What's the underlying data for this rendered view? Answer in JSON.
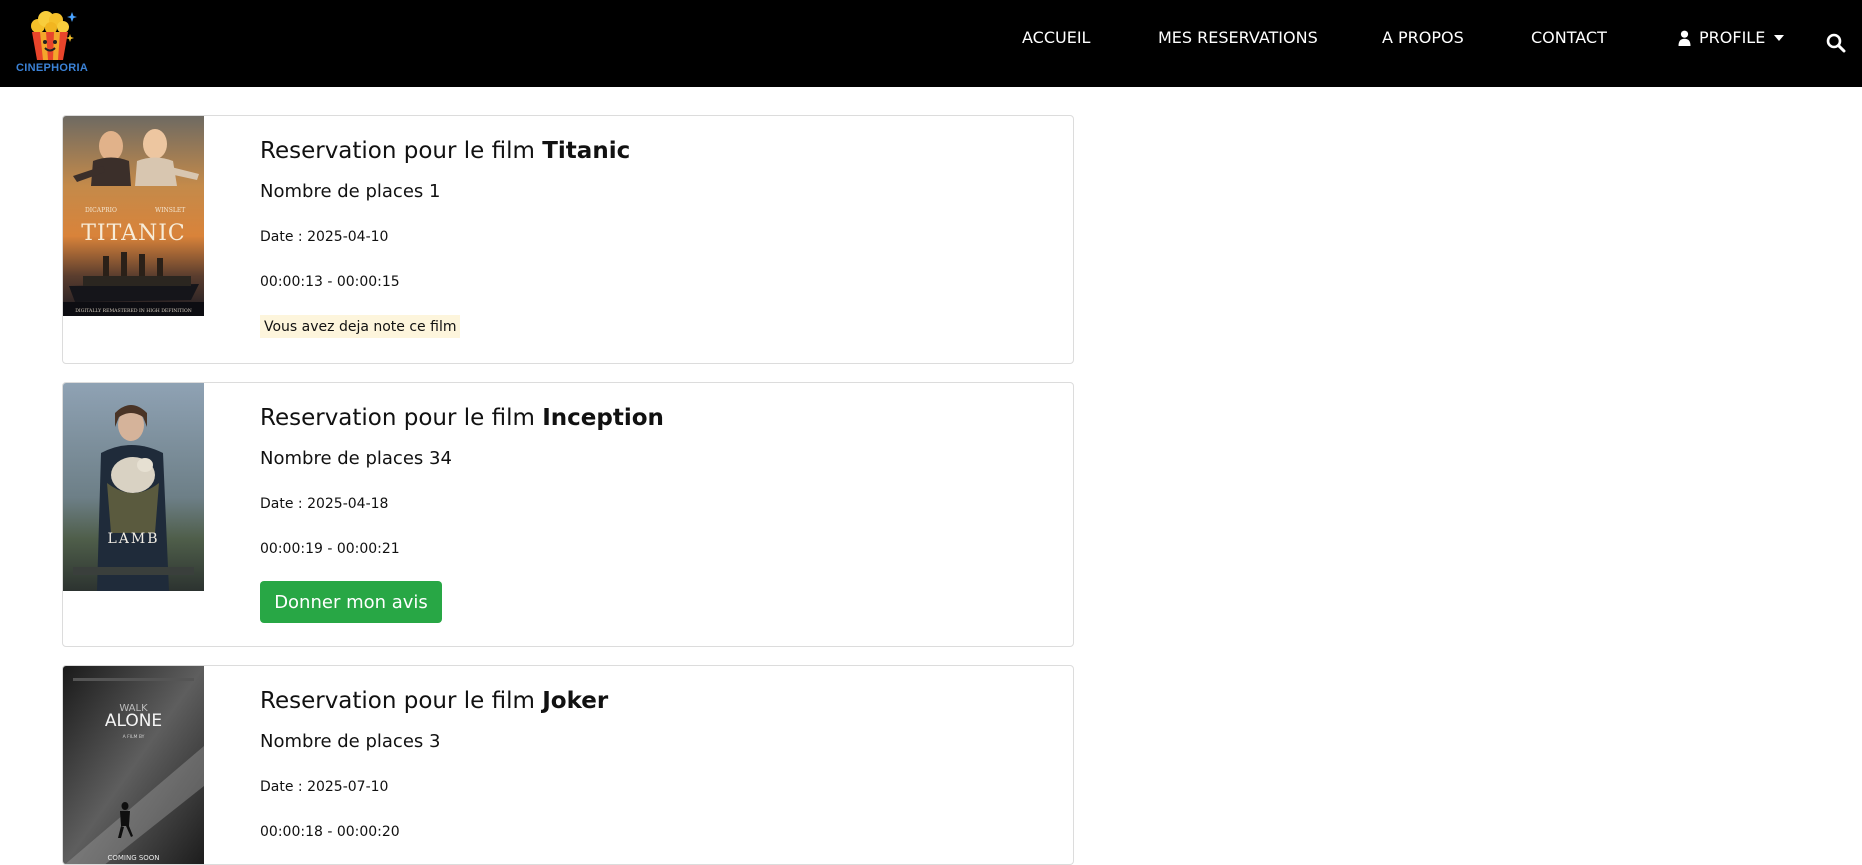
{
  "brand": {
    "name": "CINEPHORIA"
  },
  "nav": {
    "items": [
      {
        "label": "ACCUEIL"
      },
      {
        "label": "MES RESERVATIONS"
      },
      {
        "label": "A PROPOS"
      },
      {
        "label": "CONTACT"
      }
    ],
    "profile_label": "PROFILE",
    "search_icon": "search-icon"
  },
  "reservations": [
    {
      "title_prefix": "Reservation pour le film",
      "film": "Titanic",
      "places": "Nombre de places 1",
      "date": "Date : 2025-04-10",
      "time": "00:00:13 - 00:00:15",
      "status": "Vous avez deja note ce film",
      "poster": {
        "top_names": [
          "DICAPRIO",
          "WINSLET"
        ],
        "title": "TITANIC",
        "footer": "DIGITALLY REMASTERED IN HIGH DEFINITION"
      }
    },
    {
      "title_prefix": "Reservation pour le film",
      "film": "Inception",
      "places": "Nombre de places 34",
      "date": "Date : 2025-04-18",
      "time": "00:00:19 - 00:00:21",
      "action_label": "Donner mon avis",
      "poster": {
        "title": "LAMB"
      }
    },
    {
      "title_prefix": "Reservation pour le film",
      "film": "Joker",
      "places": "Nombre de places 3",
      "date": "Date : 2025-07-10",
      "time": "00:00:18 - 00:00:20",
      "poster": {
        "title_top": "WALK",
        "title_main": "ALONE",
        "byline": "A FILM BY",
        "footer": "COMING SOON"
      }
    }
  ],
  "colors": {
    "navbar_bg": "#000000",
    "brand_text": "#3b82d6",
    "action_button": "#28a745",
    "rated_badge_bg": "#fdf5dc",
    "card_border": "#dcdcdc"
  }
}
